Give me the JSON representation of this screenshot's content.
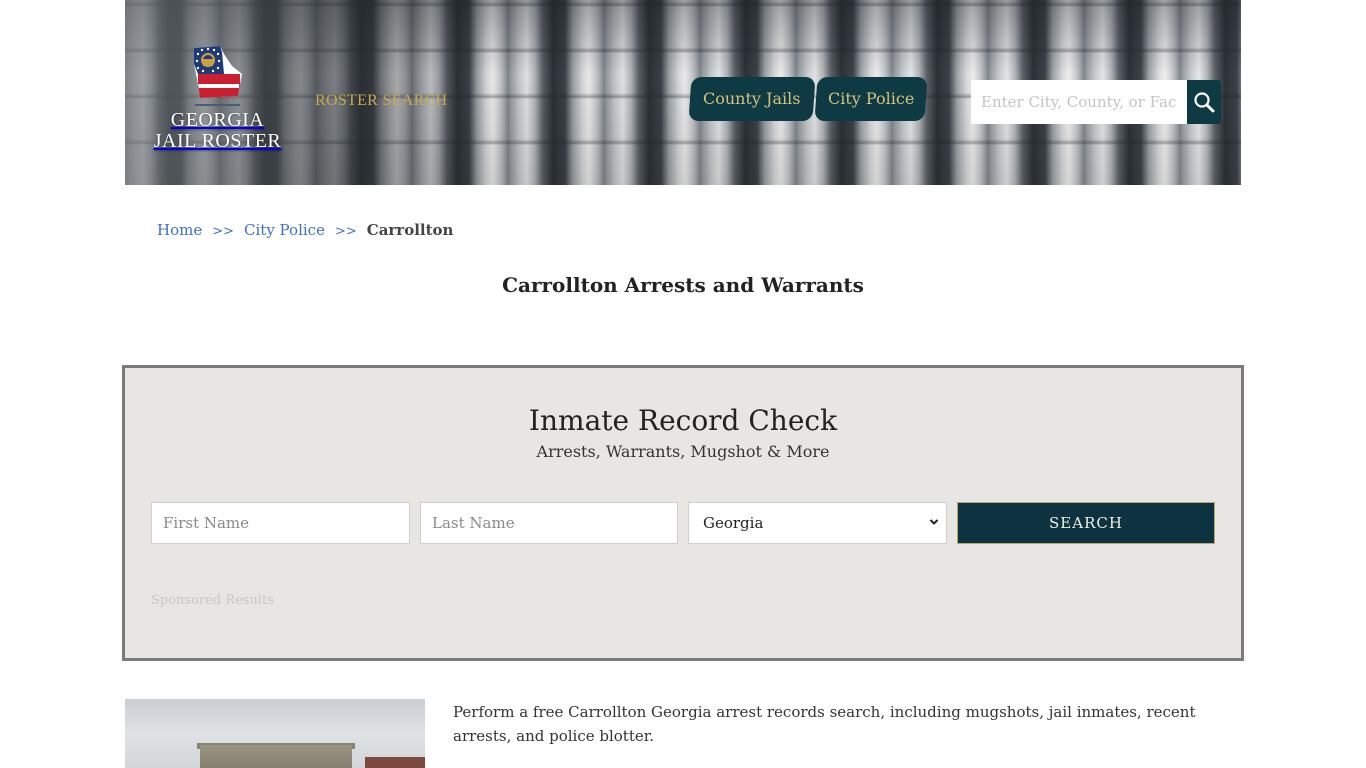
{
  "header": {
    "logo_line1": "GEORGIA",
    "logo_line2": "JAIL ROSTER",
    "roster_search": "ROSTER SEARCH",
    "nav": [
      {
        "label": "County Jails"
      },
      {
        "label": "City Police"
      }
    ],
    "search": {
      "placeholder": "Enter City, County, or Facility",
      "value": ""
    }
  },
  "breadcrumb": {
    "home": "Home",
    "sep": ">>",
    "city_police": "City Police",
    "current": "Carrollton"
  },
  "page_title": "Carrollton Arrests and Warrants",
  "record_check": {
    "title": "Inmate Record Check",
    "subtitle": "Arrests, Warrants, Mugshot & More",
    "first_name_placeholder": "First Name",
    "last_name_placeholder": "Last Name",
    "state_selected": "Georgia",
    "search_label": "SEARCH",
    "sponsored": "Sponsored Results"
  },
  "intro_text": "Perform a free Carrollton Georgia arrest records search, including mugshots, jail inmates, recent arrests, and police blotter.",
  "colors": {
    "primary": "#0e3a44",
    "accent_gold": "#c9a94e",
    "link": "#3d6fc4",
    "panel": "#e8e6e2"
  }
}
